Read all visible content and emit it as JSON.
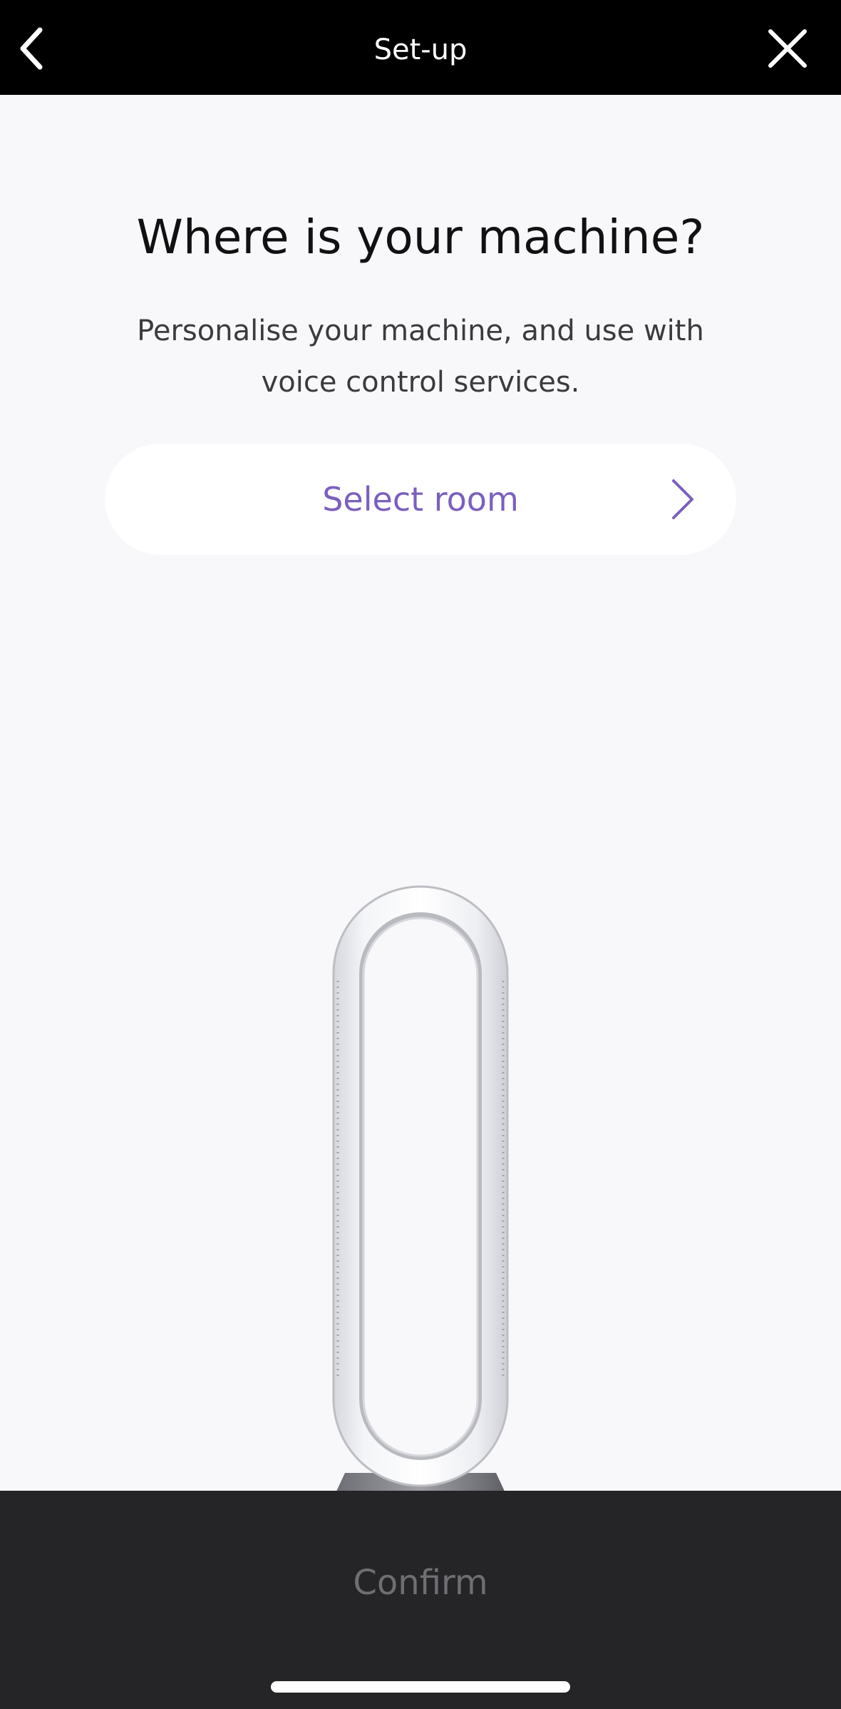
{
  "topbar": {
    "title": "Set-up",
    "back_icon": "chevron-left-icon",
    "close_icon": "close-icon"
  },
  "main": {
    "heading": "Where is your machine?",
    "subtitle": "Personalise your machine, and use with voice control services.",
    "select_room": {
      "label": "Select room",
      "icon": "chevron-right-icon"
    },
    "product_image": "bladeless-fan-image"
  },
  "footer": {
    "confirm_label": "Confirm"
  },
  "colors": {
    "background": "#f8f7fa",
    "topbar": "#000000",
    "accent": "#7b5fc0",
    "footer": "#252427",
    "confirm_disabled": "#6f6e72"
  }
}
